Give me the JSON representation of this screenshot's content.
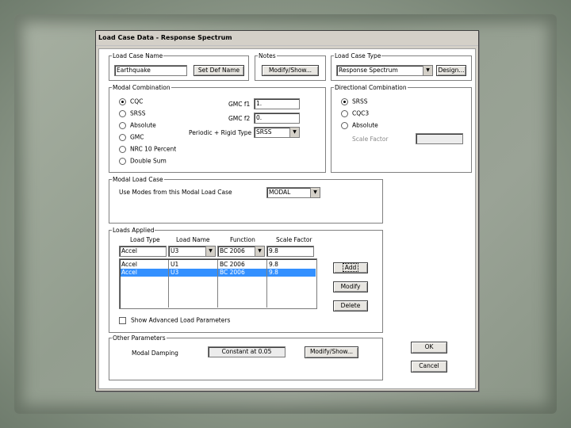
{
  "dialog": {
    "title": "Load Case Data - Response Spectrum"
  },
  "load_case_name": {
    "legend": "Load Case Name",
    "value": "Earthquake",
    "set_def_name_label": "Set Def Name"
  },
  "notes": {
    "legend": "Notes",
    "modify_show_label": "Modify/Show..."
  },
  "load_case_type": {
    "legend": "Load Case Type",
    "selected": "Response Spectrum",
    "design_label": "Design..."
  },
  "modal_combination": {
    "legend": "Modal Combination",
    "options": [
      "CQC",
      "SRSS",
      "Absolute",
      "GMC",
      "NRC 10 Percent",
      "Double Sum"
    ],
    "selected_index": 0,
    "gmc_f1_label": "GMC f1",
    "gmc_f1_value": "1.",
    "gmc_f2_label": "GMC f2",
    "gmc_f2_value": "0.",
    "periodic_rigid_label": "Periodic + Rigid Type",
    "periodic_rigid_value": "SRSS"
  },
  "directional_combination": {
    "legend": "Directional Combination",
    "options": [
      "SRSS",
      "CQC3",
      "Absolute"
    ],
    "selected_index": 0,
    "scale_factor_label": "Scale Factor",
    "scale_factor_value": ""
  },
  "modal_load_case": {
    "legend": "Modal Load Case",
    "label": "Use Modes from this Modal Load Case",
    "selected": "MODAL"
  },
  "loads_applied": {
    "legend": "Loads Applied",
    "headers": [
      "Load Type",
      "Load Name",
      "Function",
      "Scale Factor"
    ],
    "edit_row": [
      "Accel",
      "U3",
      "BC 2006",
      "9.8"
    ],
    "rows": [
      [
        "Accel",
        "U1",
        "BC 2006",
        "9.8"
      ],
      [
        "Accel",
        "U3",
        "BC 2006",
        "9.8"
      ]
    ],
    "selected_row": 1,
    "add_label": "Add",
    "modify_label": "Modify",
    "delete_label": "Delete",
    "show_advanced_label": "Show Advanced Load Parameters"
  },
  "other_parameters": {
    "legend": "Other Parameters",
    "modal_damping_label": "Modal Damping",
    "modal_damping_value": "Constant at 0.05",
    "modify_show_label": "Modify/Show..."
  },
  "ok_label": "OK",
  "cancel_label": "Cancel"
}
